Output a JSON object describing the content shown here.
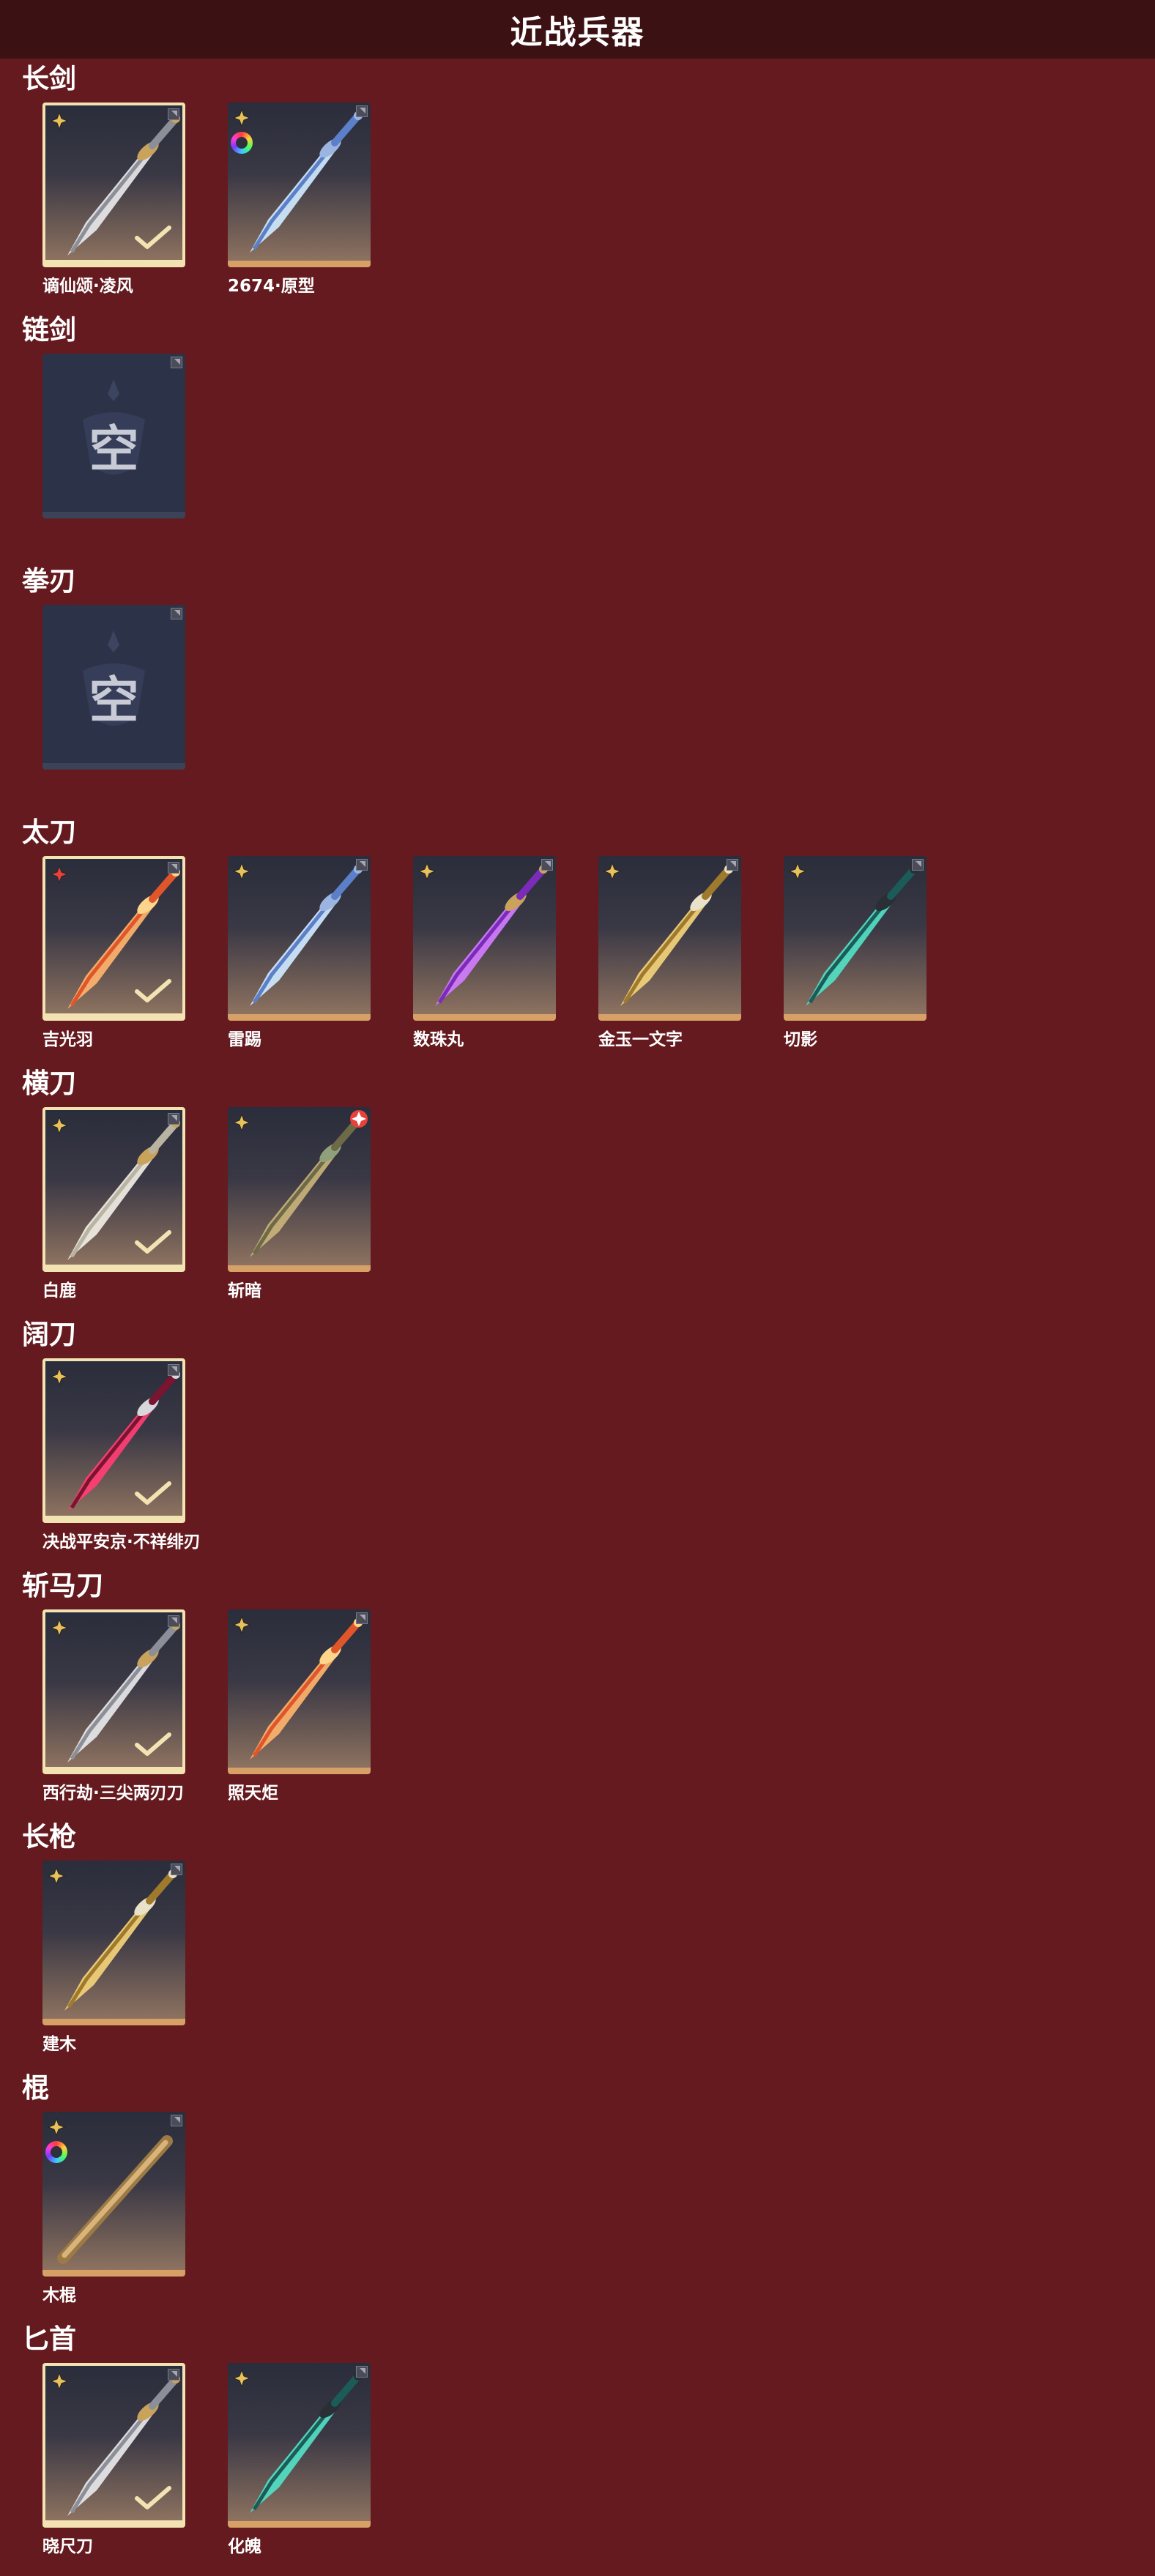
{
  "header": {
    "title": "近战兵器"
  },
  "categories": [
    {
      "title": "长剑",
      "items": [
        {
          "name": "谪仙颂·凌风",
          "selected": true,
          "badge": "gold-star-icon",
          "style": "silver"
        },
        {
          "name": "2674·原型",
          "selected": false,
          "badge": "gold-star-icon",
          "rainbow": true,
          "style": "blue"
        }
      ]
    },
    {
      "title": "链剑",
      "empty_label": "空",
      "items": []
    },
    {
      "title": "拳刃",
      "empty_label": "空",
      "items": []
    },
    {
      "title": "太刀",
      "items": [
        {
          "name": "吉光羽",
          "selected": true,
          "badge": "red-star-icon",
          "style": "fire"
        },
        {
          "name": "雷踢",
          "selected": false,
          "badge": "gold-star-icon",
          "style": "blue"
        },
        {
          "name": "数珠丸",
          "selected": false,
          "badge": "gold-star-icon",
          "style": "purple"
        },
        {
          "name": "金玉一文字",
          "selected": false,
          "badge": "gold-star-icon",
          "style": "gold"
        },
        {
          "name": "切影",
          "selected": false,
          "badge": "gold-star-icon",
          "style": "teal"
        }
      ]
    },
    {
      "title": "横刀",
      "items": [
        {
          "name": "白鹿",
          "selected": true,
          "badge": "gold-star-icon",
          "style": "ivory"
        },
        {
          "name": "斩暗",
          "selected": false,
          "badge": "gold-star-icon",
          "redmark": true,
          "style": "bronze"
        }
      ]
    },
    {
      "title": "阔刀",
      "items": [
        {
          "name": "决战平安京·不祥绯刃",
          "selected": true,
          "badge": "gold-star-icon",
          "style": "crimson"
        }
      ]
    },
    {
      "title": "斩马刀",
      "items": [
        {
          "name": "西行劫·三尖两刃刀",
          "selected": true,
          "badge": "gold-star-icon",
          "style": "silver"
        },
        {
          "name": "照天炬",
          "selected": false,
          "badge": "gold-star-icon",
          "style": "fire"
        }
      ]
    },
    {
      "title": "长枪",
      "items": [
        {
          "name": "建木",
          "selected": false,
          "badge": "gold-star-icon",
          "style": "gold"
        }
      ]
    },
    {
      "title": "棍",
      "items": [
        {
          "name": "木棍",
          "selected": false,
          "badge": "gold-star-icon",
          "rainbow": true,
          "style": "wood"
        }
      ]
    },
    {
      "title": "匕首",
      "items": [
        {
          "name": "晓尺刀",
          "selected": true,
          "badge": "gold-star-icon",
          "style": "silver"
        },
        {
          "name": "化魄",
          "selected": false,
          "badge": "gold-star-icon",
          "style": "teal"
        }
      ]
    }
  ],
  "colors": {
    "background": "#641a1f",
    "header": "#3c1114",
    "selected_border": "#f4e3b2",
    "rarity_bar": "#d6a067",
    "empty_tile": "#2c3348"
  }
}
